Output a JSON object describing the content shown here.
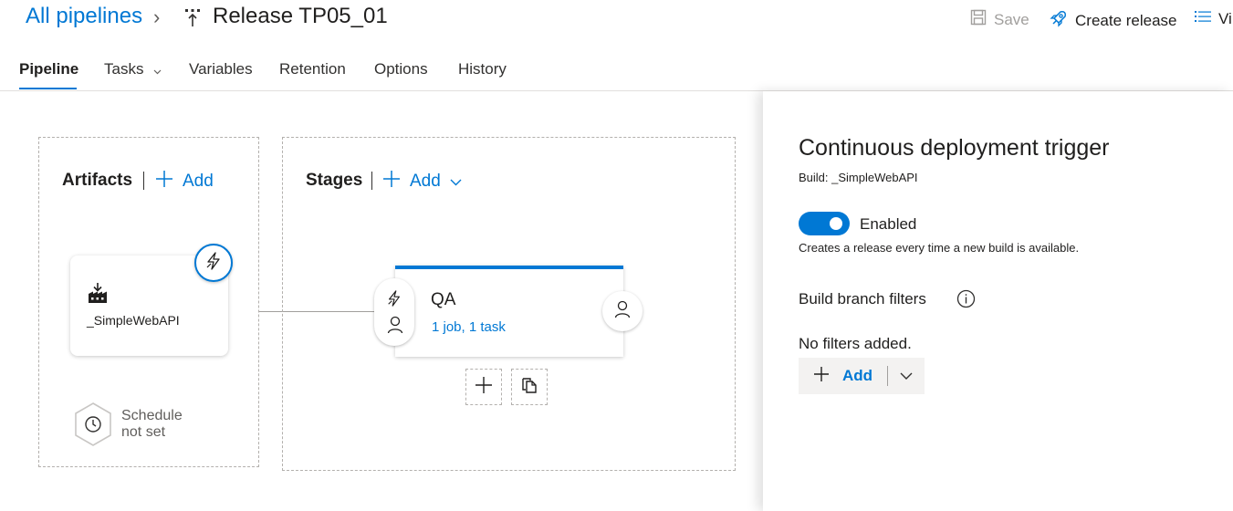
{
  "header": {
    "breadcrumb": "All pipelines",
    "separator": "›",
    "title": "Release TP05_01",
    "save_label": "Save",
    "create_release_label": "Create release",
    "view_label": "Vi"
  },
  "tabs": [
    {
      "label": "Pipeline",
      "active": true
    },
    {
      "label": "Tasks",
      "active": false
    },
    {
      "label": "Variables",
      "active": false
    },
    {
      "label": "Retention",
      "active": false
    },
    {
      "label": "Options",
      "active": false
    },
    {
      "label": "History",
      "active": false
    }
  ],
  "artifacts": {
    "title": "Artifacts",
    "add_label": "Add",
    "artifact_name": "_SimpleWebAPI",
    "schedule_line1": "Schedule",
    "schedule_line2": "not set"
  },
  "stages": {
    "title": "Stages",
    "add_label": "Add",
    "stage_name": "QA",
    "stage_detail": "1 job, 1 task"
  },
  "panel": {
    "title": "Continuous deployment trigger",
    "subtitle": "Build: _SimpleWebAPI",
    "toggle_label": "Enabled",
    "toggle_on": true,
    "toggle_desc": "Creates a release every time a new build is available.",
    "filters_title": "Build branch filters",
    "no_filters": "No filters added.",
    "add_label": "Add"
  },
  "colors": {
    "accent": "#0078d4",
    "disabled": "#a19f9d"
  }
}
